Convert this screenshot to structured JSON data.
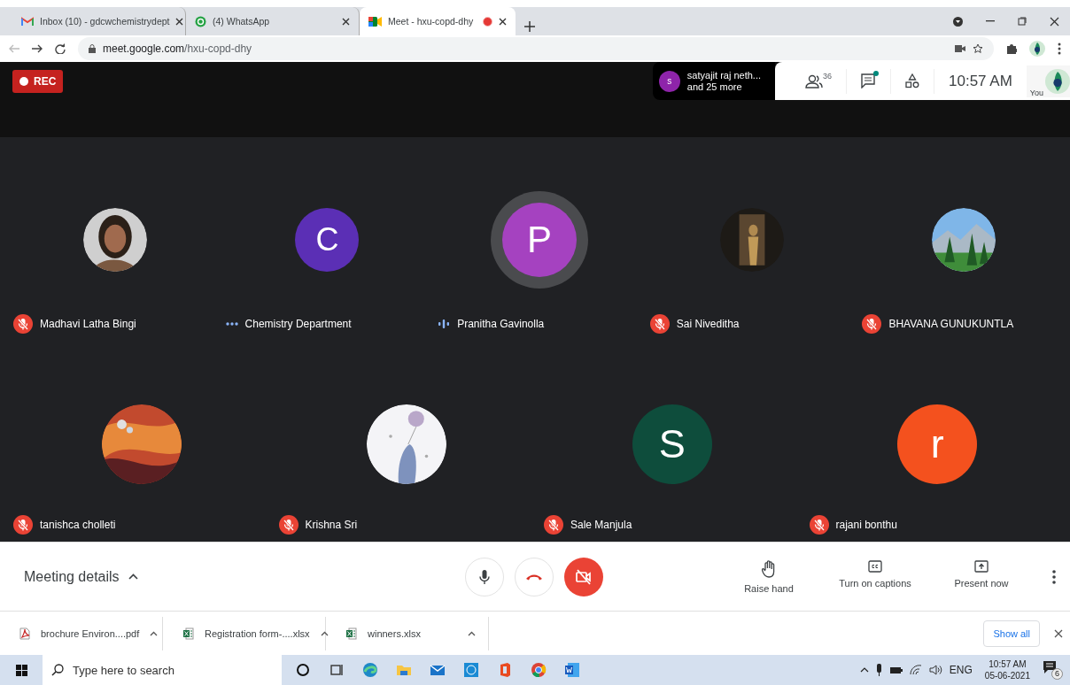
{
  "browser": {
    "tabs": [
      {
        "title": "Inbox (10) - gdcwchemistrydept",
        "kind": "mail",
        "selected": false,
        "recording": false
      },
      {
        "title": "(4) WhatsApp",
        "kind": "chat",
        "selected": false,
        "recording": false
      },
      {
        "title": "Meet - hxu-copd-dhy",
        "kind": "meet",
        "selected": true,
        "recording": true
      }
    ],
    "url_host": "meet.google.com",
    "url_path": "/hxu-copd-dhy"
  },
  "meet": {
    "rec": "REC",
    "presenter": {
      "letter": "s",
      "name": "satyajit raj neth...",
      "more": "and 25 more"
    },
    "people_count": "36",
    "chat_unread": true,
    "time": "10:57 AM",
    "you": "You",
    "participants": [
      {
        "name": "Madhavi Latha Bingi",
        "muted": true,
        "speaking": false
      },
      {
        "name": "Chemistry Department",
        "muted": false,
        "speaking": false,
        "avatar": {
          "kind": "letter",
          "letter": "C",
          "color": "#5b2fb5"
        }
      },
      {
        "name": "Pranitha Gavinolla",
        "muted": false,
        "speaking": true,
        "avatar": {
          "kind": "letter",
          "letter": "P",
          "color": "#a542c0"
        }
      },
      {
        "name": "Sai Niveditha",
        "muted": true,
        "speaking": false
      },
      {
        "name": "BHAVANA GUNUKUNTLA",
        "muted": true,
        "speaking": false
      },
      {
        "name": "tanishca cholleti",
        "muted": true,
        "speaking": false
      },
      {
        "name": "Krishna Sri",
        "muted": true,
        "speaking": false
      },
      {
        "name": "Sale Manjula",
        "muted": true,
        "speaking": false,
        "avatar": {
          "kind": "letter",
          "letter": "S",
          "color": "#0e4d3c"
        }
      },
      {
        "name": "rajani bonthu",
        "muted": true,
        "speaking": false,
        "avatar": {
          "kind": "letter",
          "letter": "r",
          "color": "#f4511e"
        }
      }
    ],
    "controls": {
      "details": "Meeting details",
      "camera_on": false,
      "actions": [
        {
          "label": "Raise hand",
          "kind": "hand"
        },
        {
          "label": "Turn on captions",
          "kind": "captions"
        },
        {
          "label": "Present now",
          "kind": "present"
        }
      ]
    }
  },
  "downloads": {
    "items": [
      {
        "name": "brochure Environ....pdf",
        "kind": "document"
      },
      {
        "name": "Registration form-....xlsx",
        "kind": "spreadsheet"
      },
      {
        "name": "winners.xlsx",
        "kind": "spreadsheet"
      }
    ],
    "show_all": "Show all"
  },
  "taskbar": {
    "search_placeholder": "Type here to search",
    "language": "ENG",
    "time": "10:57 AM",
    "date": "05-06-2021",
    "notifications": "6"
  }
}
